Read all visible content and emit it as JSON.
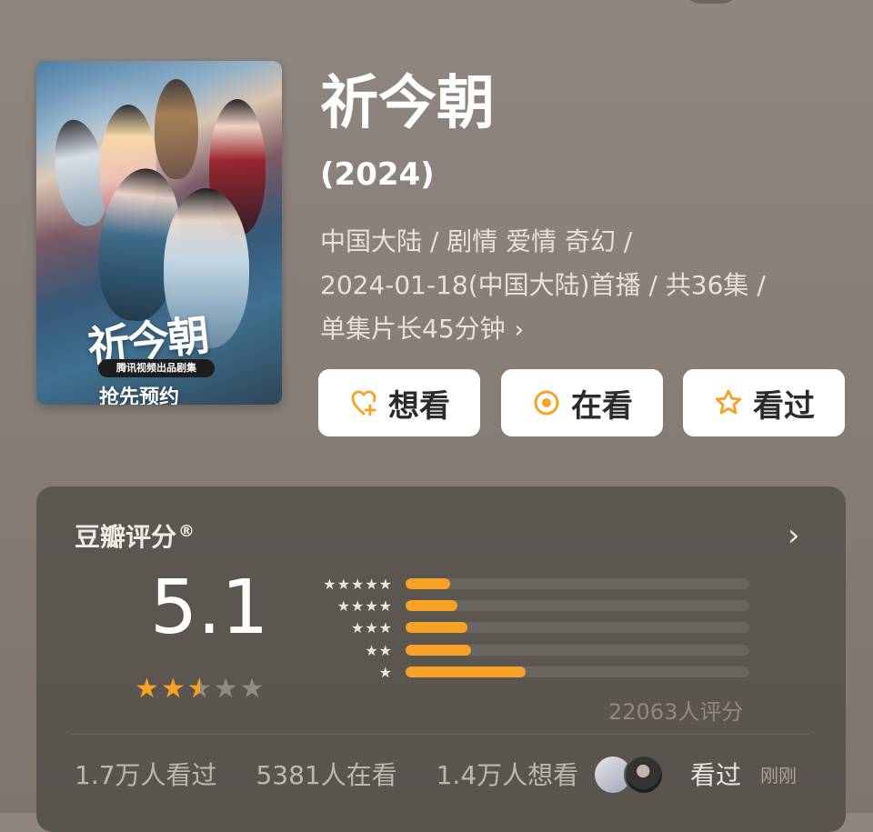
{
  "show": {
    "title": "祈今朝",
    "year": "(2024)",
    "meta_line1": "中国大陆 / 剧情 爱情 奇幻 /",
    "meta_line2": "2024-01-18(中国大陆)首播 / 共36集 /",
    "meta_line3": "单集片长45分钟",
    "chevron": "›",
    "poster": {
      "title_text": "祈今朝",
      "badge_text": "腾讯视频出品剧集",
      "cta_text": "抢先预约"
    }
  },
  "actions": [
    {
      "label": "想看",
      "icon": "heart-plus-icon"
    },
    {
      "label": "在看",
      "icon": "target-circle-icon"
    },
    {
      "label": "看过",
      "icon": "star-outline-icon"
    }
  ],
  "rating": {
    "title": "豆瓣评分",
    "registered_mark": "®",
    "score": "5.1",
    "score_stars": 2.5,
    "distribution": [
      {
        "stars": "★★★★★",
        "percent": 13
      },
      {
        "stars": "★★★★",
        "percent": 15
      },
      {
        "stars": "★★★",
        "percent": 18
      },
      {
        "stars": "★★",
        "percent": 19
      },
      {
        "stars": "★",
        "percent": 35
      }
    ],
    "count_text": "22063人评分",
    "stats": {
      "watched": "1.7万人看过",
      "watching": "5381人在看",
      "want": "1.4万人想看"
    },
    "recent_action": "看过",
    "recent_time": "刚刚"
  },
  "colors": {
    "accent": "#f7a126",
    "panel": "#5a544f",
    "background": "#857d75"
  }
}
